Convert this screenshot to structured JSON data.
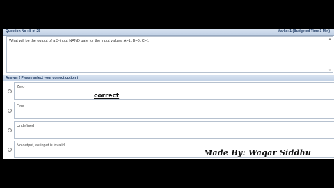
{
  "question": {
    "number_label": "Question No : 8 of 25",
    "marks_label": "Marks: 1 (Budgeted Time 1 Min)",
    "text": "What will be the output of a 3-input NAND gate for the input values: A=1, B=0, C=1"
  },
  "answer": {
    "header": "Answer ( Please select your correct option )",
    "options": [
      {
        "label": "Zero"
      },
      {
        "label": "One"
      },
      {
        "label": "Undefined"
      },
      {
        "label": "No output, as input is invalid"
      }
    ]
  },
  "annotation": {
    "correct_label": "correct"
  },
  "watermark": {
    "text": "Made By: Waqar Siddhu"
  },
  "colors": {
    "header_bg": "#c8d6e8",
    "header_text": "#1f3b63",
    "border": "#b6c1cf",
    "background": "#000000"
  }
}
